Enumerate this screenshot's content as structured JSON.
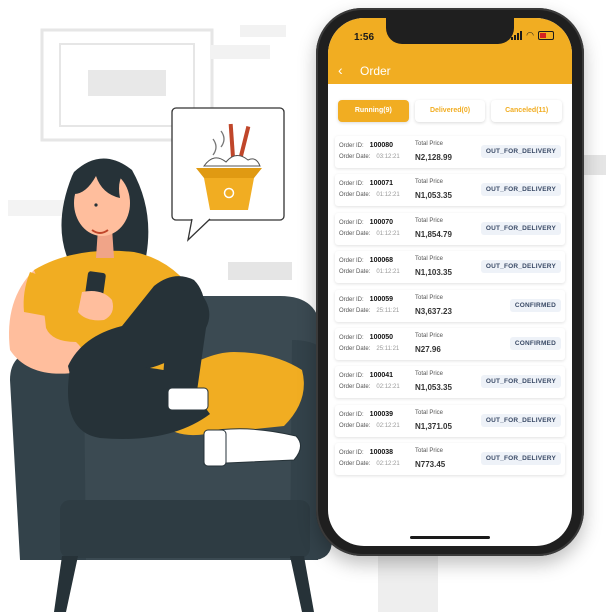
{
  "status_bar": {
    "time": "1:56"
  },
  "app_bar": {
    "back_icon": "back-arrow-icon",
    "title": "Order"
  },
  "tabs": [
    {
      "label": "Running(9)",
      "active": true
    },
    {
      "label": "Delivered(0)",
      "active": false
    },
    {
      "label": "Canceled(11)",
      "active": false
    }
  ],
  "order_labels": {
    "id": "Order ID:",
    "date": "Order Date:",
    "price": "Total Price"
  },
  "orders": [
    {
      "id": "100080",
      "date": "03:12:21",
      "price": "N2,128.99",
      "status": "OUT_FOR_DELIVERY"
    },
    {
      "id": "100071",
      "date": "01:12:21",
      "price": "N1,053.35",
      "status": "OUT_FOR_DELIVERY"
    },
    {
      "id": "100070",
      "date": "01:12:21",
      "price": "N1,854.79",
      "status": "OUT_FOR_DELIVERY"
    },
    {
      "id": "100068",
      "date": "01:12:21",
      "price": "N1,103.35",
      "status": "OUT_FOR_DELIVERY"
    },
    {
      "id": "100059",
      "date": "25:11:21",
      "price": "N3,637.23",
      "status": "CONFIRMED"
    },
    {
      "id": "100050",
      "date": "25:11:21",
      "price": "N27.96",
      "status": "CONFIRMED"
    },
    {
      "id": "100041",
      "date": "02:12:21",
      "price": "N1,053.35",
      "status": "OUT_FOR_DELIVERY"
    },
    {
      "id": "100039",
      "date": "02:12:21",
      "price": "N1,371.05",
      "status": "OUT_FOR_DELIVERY"
    },
    {
      "id": "100038",
      "date": "02:12:21",
      "price": "N773.45",
      "status": "OUT_FOR_DELIVERY"
    }
  ],
  "colors": {
    "accent": "#f1ad22",
    "chair": "#3b4a52",
    "shirt": "#f1ad22",
    "hair": "#263238"
  }
}
